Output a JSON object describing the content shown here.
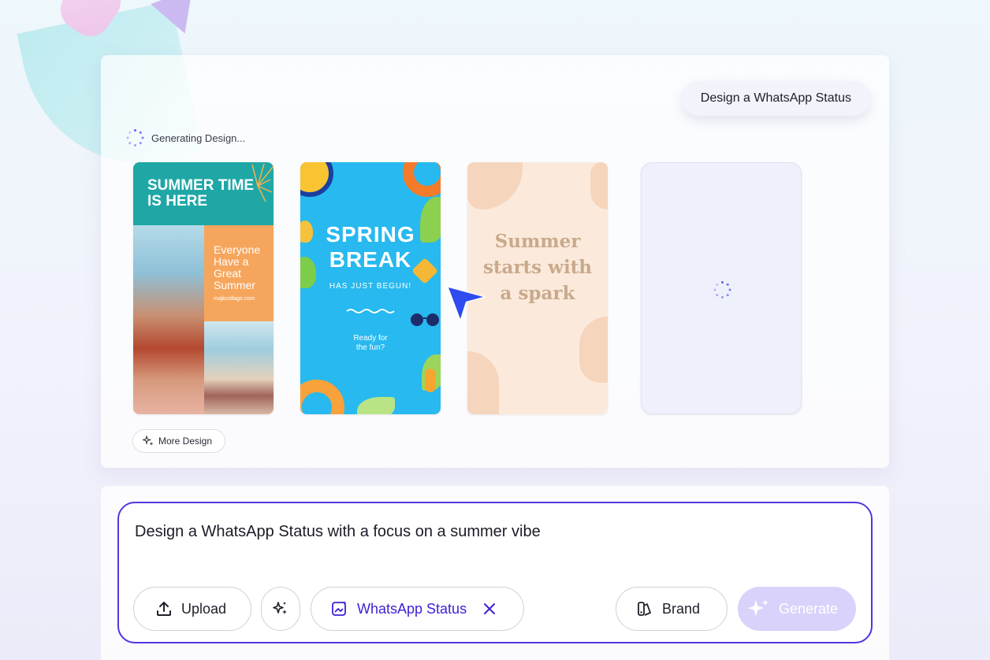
{
  "header": {
    "prompt_chip": "Design a WhatsApp Status",
    "status_text": "Generating Design..."
  },
  "designs": [
    {
      "title": "SUMMER TIME IS HERE",
      "body": "Everyone Have a Great Summer",
      "site": "majkcollage.com"
    },
    {
      "title_line1": "SPRING",
      "title_line2": "BREAK",
      "subtitle": "HAS JUST BEGUN!",
      "tagline_line1": "Ready for",
      "tagline_line2": "the fun?"
    },
    {
      "title": "Summer starts with a spark"
    }
  ],
  "more_design_label": "More Design",
  "composer": {
    "prompt": "Design a WhatsApp Status with a focus on a summer vibe",
    "upload_label": "Upload",
    "format_label": "WhatsApp Status",
    "brand_label": "Brand",
    "generate_label": "Generate"
  },
  "colors": {
    "accent": "#5036e0",
    "generate_disabled": "#d9d2fb"
  },
  "icons": [
    "sparkle-icon",
    "upload-icon",
    "magic-wand-icon",
    "format-icon",
    "close-icon",
    "brand-icon",
    "cursor-icon",
    "spinner-icon"
  ]
}
